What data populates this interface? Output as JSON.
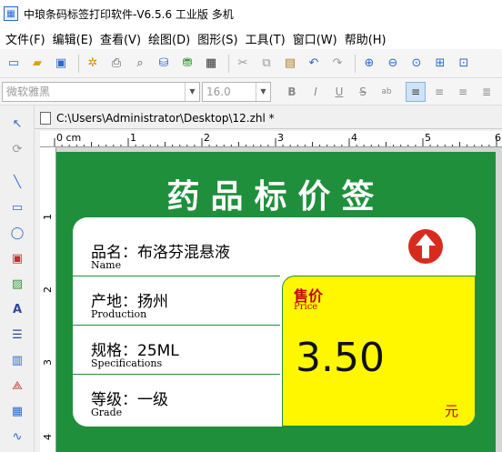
{
  "window": {
    "title": "中琅条码标签打印软件-V6.5.6 工业版 多机"
  },
  "menu": [
    "文件(F)",
    "编辑(E)",
    "查看(V)",
    "绘图(D)",
    "图形(S)",
    "工具(T)",
    "窗口(W)",
    "帮助(H)"
  ],
  "format_bar": {
    "font_name": "微软雅黑",
    "font_size": "16.0",
    "bold": "B",
    "italic": "I",
    "underline": "U",
    "strike": "S",
    "sub": "ab"
  },
  "document": {
    "path": "C:\\Users\\Administrator\\Desktop\\12.zhl *"
  },
  "ruler": {
    "top_labels": [
      "0 cm",
      "1",
      "2",
      "3",
      "4",
      "5",
      "6"
    ],
    "left_labels": [
      "1",
      "2",
      "3",
      "4"
    ]
  },
  "label": {
    "title": "药品标价签",
    "rows": [
      {
        "name": "品名：布洛芬混悬液",
        "en": "Name"
      },
      {
        "name": "产地：扬州",
        "en": "Production"
      },
      {
        "name": "规格：25ML",
        "en": "Specifications"
      },
      {
        "name": "等级：一级",
        "en": "Grade"
      }
    ],
    "price_label": "售价",
    "price_label_en": "Price",
    "price_value": "3.50",
    "price_unit": "元"
  },
  "colors": {
    "label_green": "#1f8f3c",
    "price_yellow": "#fff700",
    "price_red": "#c40000"
  }
}
